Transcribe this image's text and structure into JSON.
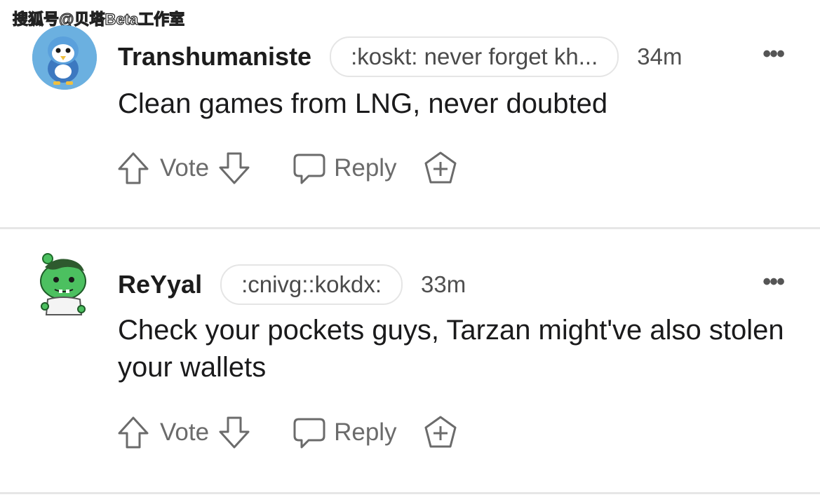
{
  "watermark": "搜狐号@贝塔Beta工作室",
  "comments": [
    {
      "username": "Transhumaniste",
      "flair": ":koskt: never forget kh...",
      "time": "34m",
      "more": "•••",
      "body": "Clean games from LNG, never doubted",
      "actions": {
        "vote": "Vote",
        "reply": "Reply"
      },
      "avatar": "penguin-avatar"
    },
    {
      "username": "ReYyal",
      "flair": ":cnivg::kokdx:",
      "time": "33m",
      "more": "•••",
      "body": "Check your pockets guys, Tarzan might've also stolen your wallets",
      "actions": {
        "vote": "Vote",
        "reply": "Reply"
      },
      "avatar": "green-creature-avatar"
    }
  ],
  "colors": {
    "text": "#1a1a1b",
    "muted": "#6b6b6b",
    "separator": "#e6e6e6"
  }
}
